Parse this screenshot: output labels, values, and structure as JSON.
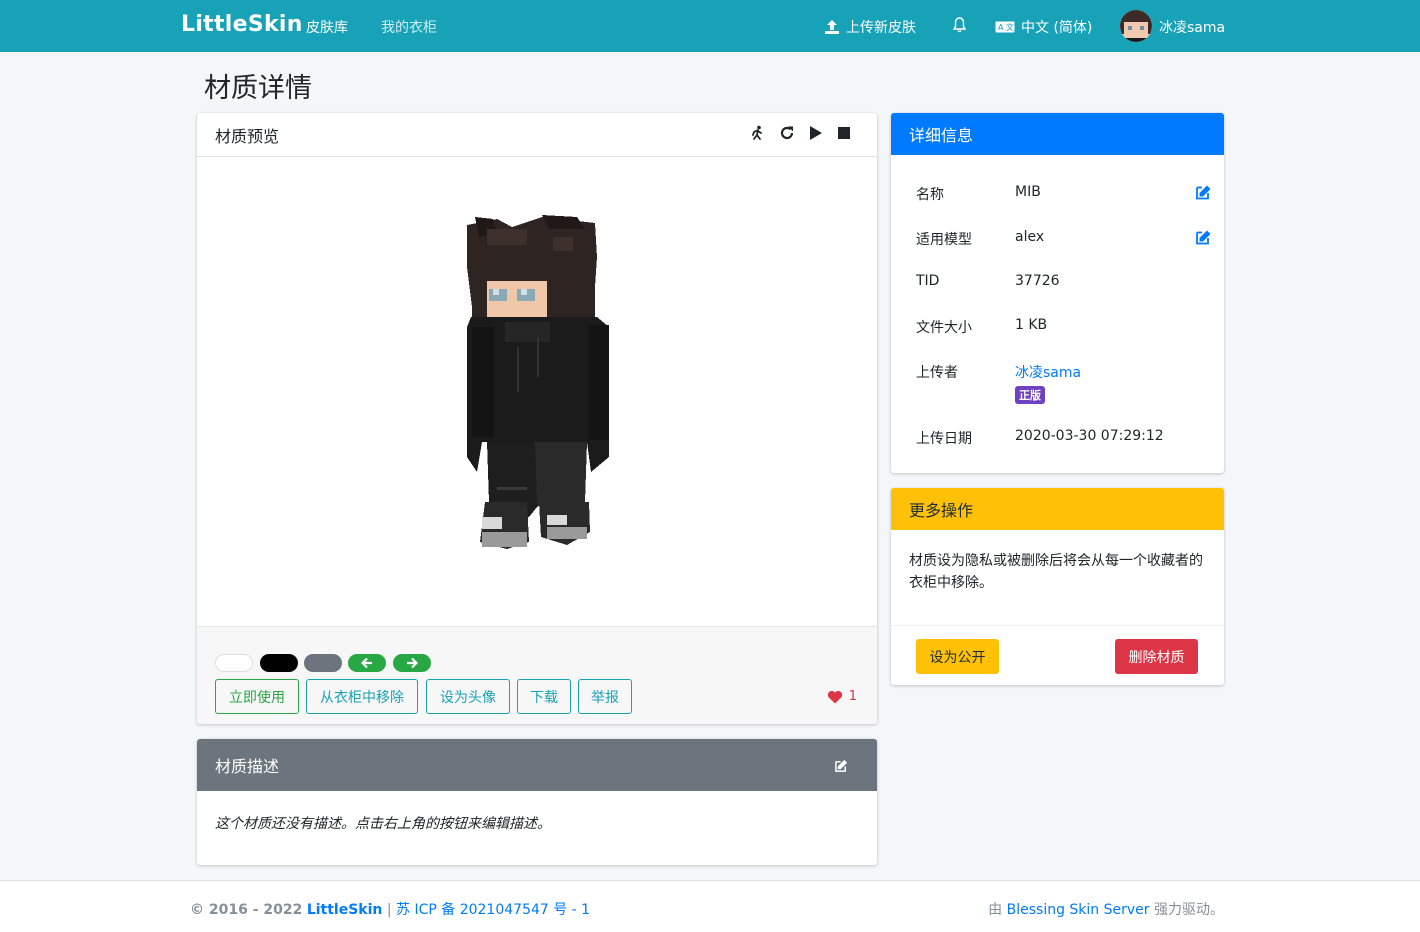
{
  "navbar": {
    "brand": "LittleSkin",
    "links": [
      "皮肤库",
      "我的衣柜"
    ],
    "upload": "上传新皮肤",
    "language": "中文 (简体)",
    "username": "冰凌sama"
  },
  "page": {
    "title": "材质详情"
  },
  "preview": {
    "title": "材质预览",
    "actions": [
      "立即使用",
      "从衣柜中移除",
      "设为头像",
      "下载",
      "举报"
    ],
    "likes": "1",
    "colors": {
      "white_toggle": "#ffffff",
      "black_toggle": "#000000",
      "gray_toggle": "#6c757d",
      "arrow_green": "#28a745"
    }
  },
  "description": {
    "title": "材质描述",
    "empty_text": "这个材质还没有描述。点击右上角的按钮来编辑描述。"
  },
  "info": {
    "title": "详细信息",
    "rows": [
      {
        "label": "名称",
        "value": "MIB"
      },
      {
        "label": "适用模型",
        "value": "alex"
      },
      {
        "label": "TID",
        "value": "37726"
      },
      {
        "label": "文件大小",
        "value": "1 KB"
      },
      {
        "label": "上传者",
        "value": "冰凌sama"
      },
      {
        "label": "上传日期",
        "value": "2020-03-30 07:29:12"
      }
    ],
    "uploader_badge": "正版"
  },
  "more": {
    "title": "更多操作",
    "text": "材质设为隐私或被删除后将会从每一个收藏者的衣柜中移除。",
    "public_button": "设为公开",
    "delete_button": "删除材质"
  },
  "footer": {
    "copyright": "© 2016 - 2022",
    "brand": "LittleSkin",
    "separator": "|",
    "icp": "苏 ICP 备 2021047547 号 - 1",
    "powered_prefix": "由",
    "powered_link": "Blessing Skin Server",
    "powered_suffix": "强力驱动。"
  }
}
